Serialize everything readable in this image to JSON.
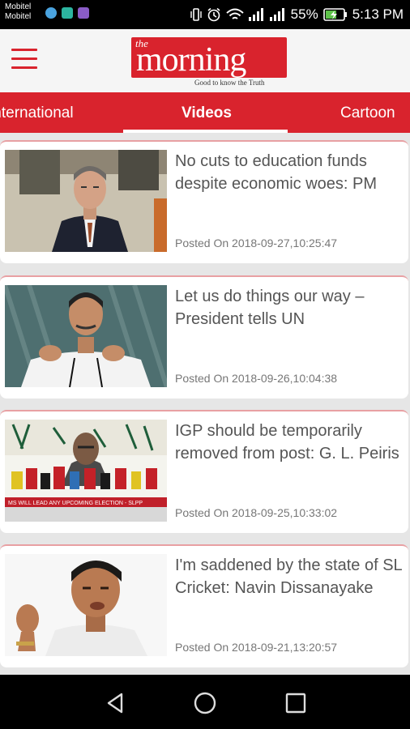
{
  "status": {
    "carrier_top": "Mobitel",
    "carrier_bottom": "Mobitel",
    "battery": "55%",
    "time": "5:13 PM"
  },
  "app": {
    "logo_small": "the",
    "logo_main": "morning",
    "tagline": "Good to know the Truth"
  },
  "tabs": [
    {
      "label": "International"
    },
    {
      "label": "Videos",
      "active": true
    },
    {
      "label": "Cartoon"
    }
  ],
  "articles": [
    {
      "title": "No cuts to education funds despite economic woes: PM",
      "posted": "Posted On 2018-09-27,10:25:47"
    },
    {
      "title": "Let us do things our way – President tells UN",
      "posted": "Posted On 2018-09-26,10:04:38"
    },
    {
      "title": "IGP should be temporarily removed from post: G. L. Peiris",
      "posted": "Posted On 2018-09-25,10:33:02"
    },
    {
      "title": "I'm saddened by the state of SL Cricket: Navin Dissanayake",
      "posted": "Posted On 2018-09-21,13:20:57"
    }
  ],
  "thumb3_banner": "MS WILL LEAD ANY UPCOMING ELECTION - SLPP",
  "colors": {
    "brand": "#d9232d",
    "background": "#e6e6e6"
  }
}
